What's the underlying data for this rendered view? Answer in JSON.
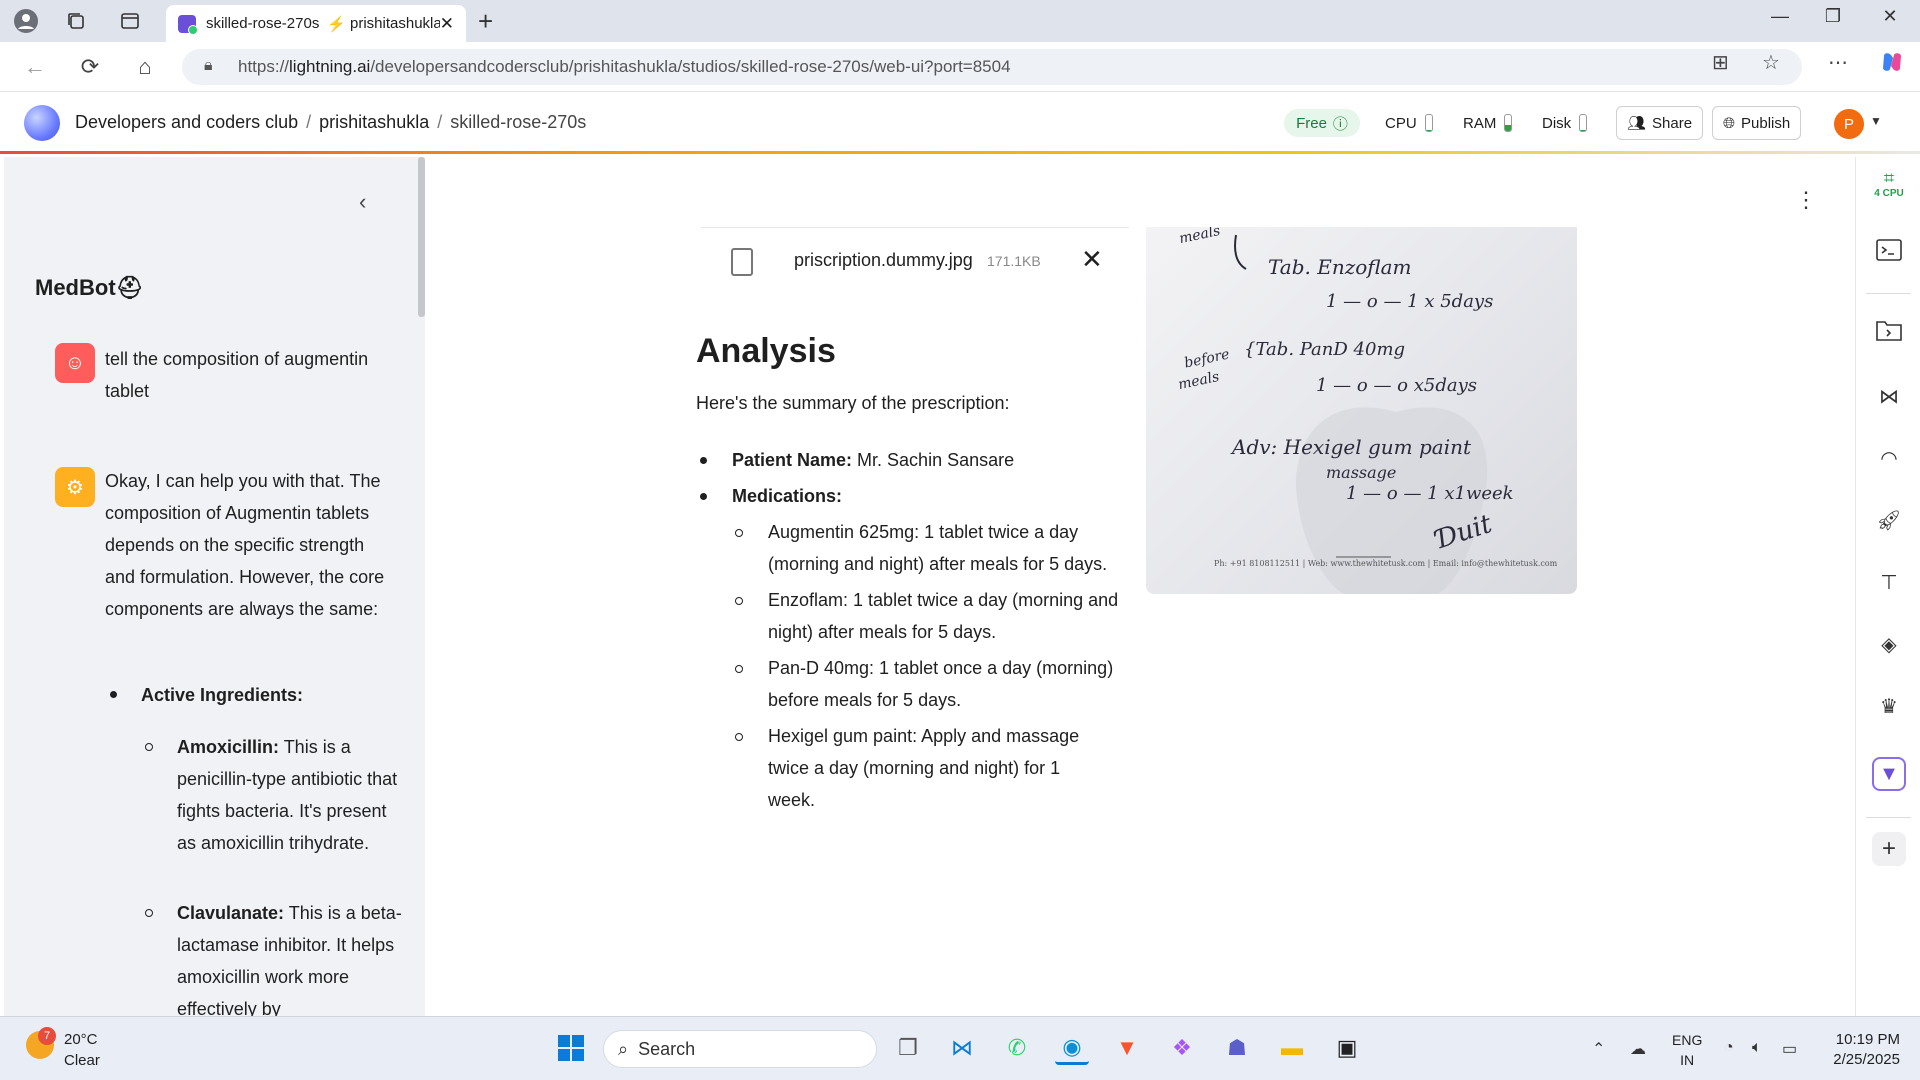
{
  "browser": {
    "tab_title": "skilled-rose-270s",
    "tab_title_2": "prishitashukla",
    "url_prefix": "https://",
    "url_host": "lightning.ai",
    "url_path": "/developersandcodersclub/prishitashukla/studios/skilled-rose-270s/web-ui?port=8504"
  },
  "header": {
    "crumb_1": "Developers and coders club",
    "crumb_2": "prishitashukla",
    "crumb_3": "skilled-rose-270s",
    "separator": "/",
    "free_label": "Free",
    "cpu_label": "CPU",
    "ram_label": "RAM",
    "disk_label": "Disk",
    "share_label": "Share",
    "publish_label": "Publish",
    "avatar_initial": "P",
    "usage": {
      "cpu": 0.05,
      "ram": 0.35,
      "disk": 0.05
    }
  },
  "sidebar": {
    "title": "MedBot",
    "user_message": "tell the composition of augmentin tablet",
    "bot_message": "Okay, I can help you with that. The composition of Augmentin tablets depends on the specific strength and formulation. However, the core components are always the same:",
    "section_label": "Active Ingredients:",
    "items": [
      {
        "bold": "Amoxicillin:",
        "text": " This is a penicillin-type antibiotic that fights bacteria. It's present as amoxicillin trihydrate."
      },
      {
        "bold": "Clavulanate:",
        "text": " This is a beta-lactamase inhibitor. It helps amoxicillin work more effectively by"
      }
    ]
  },
  "main": {
    "file_name": "priscription.dummy.jpg",
    "file_size": "171.1KB",
    "heading": "Analysis",
    "intro": "Here's the summary of the prescription:",
    "patient_label": "Patient Name:",
    "patient_value": " Mr. Sachin Sansare",
    "medications_label": "Medications:",
    "medications": [
      "Augmentin 625mg: 1 tablet twice a day (morning and night) after meals for 5 days.",
      "Enzoflam: 1 tablet twice a day (morning and night) after meals for 5 days.",
      "Pan-D 40mg: 1 tablet once a day (morning) before meals for 5 days.",
      "Hexigel gum paint: Apply and massage twice a day (morning and night) for 1 week."
    ]
  },
  "prescription_image": {
    "line_meals": "meals",
    "line_enzoflam": "Tab. Enzoflam",
    "line_dose1": "1 — o — 1  x 5days",
    "line_before": "before",
    "line_meals2": "meals",
    "line_pand": "{Tab. PanD 40mg",
    "line_dose2": "1 — o — o  x5days",
    "line_adv": "Adv: Hexigel gum paint",
    "line_massage": "massage",
    "line_dose3": "1 — o — 1   x1week",
    "footer": "Ph: +91 8108112511 | Web: www.thewhitetusk.com | Email: info@thewhitetusk.com"
  },
  "rail": {
    "cpu_badge": "4 CPU"
  },
  "taskbar": {
    "temp": "20°C",
    "weather": "Clear",
    "weather_badge": "7",
    "search_label": "Search",
    "lang_1": "ENG",
    "lang_2": "IN",
    "time": "10:19 PM",
    "date": "2/25/2025"
  }
}
